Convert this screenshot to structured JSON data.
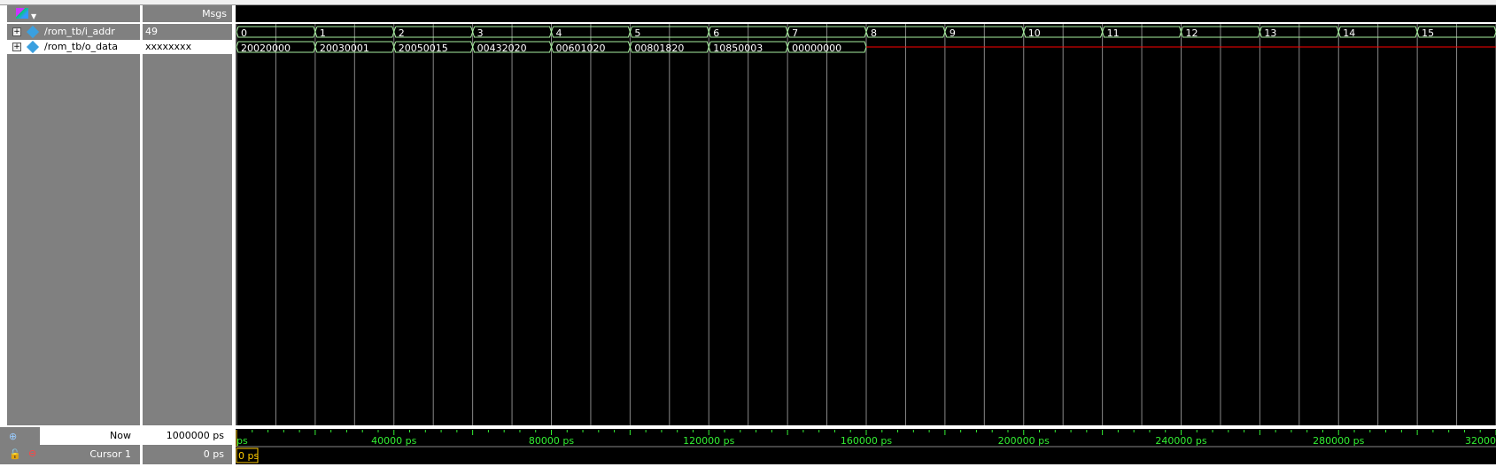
{
  "header": {
    "msgs_label": "Msgs"
  },
  "signals": [
    {
      "name": "/rom_tb/i_addr",
      "value": "49",
      "segments": [
        "0",
        "1",
        "2",
        "3",
        "4",
        "5",
        "6",
        "7",
        "8",
        "9",
        "10",
        "11",
        "12",
        "13",
        "14",
        "15"
      ]
    },
    {
      "name": "/rom_tb/o_data",
      "value": "xxxxxxxx",
      "segments": [
        "20020000",
        "20030001",
        "20050015",
        "00432020",
        "00601020",
        "00801820",
        "10850003",
        "00000000"
      ]
    }
  ],
  "timing": {
    "period_ps": 20000,
    "view_start_ps": 0,
    "view_end_ps": 320000
  },
  "now": {
    "label": "Now",
    "value": "1000000 ps"
  },
  "cursor": {
    "label": "Cursor 1",
    "value": "0 ps",
    "marker": "0 ps"
  },
  "ruler": {
    "labels": [
      "ps",
      "40000 ps",
      "80000 ps",
      "120000 ps",
      "160000 ps",
      "200000 ps",
      "240000 ps",
      "280000 ps",
      "32000"
    ]
  },
  "colors": {
    "wave": "#a8f0a0",
    "undefined": "#ff0000",
    "ruler": "#33ee33",
    "cursor": "#ffcc00"
  }
}
